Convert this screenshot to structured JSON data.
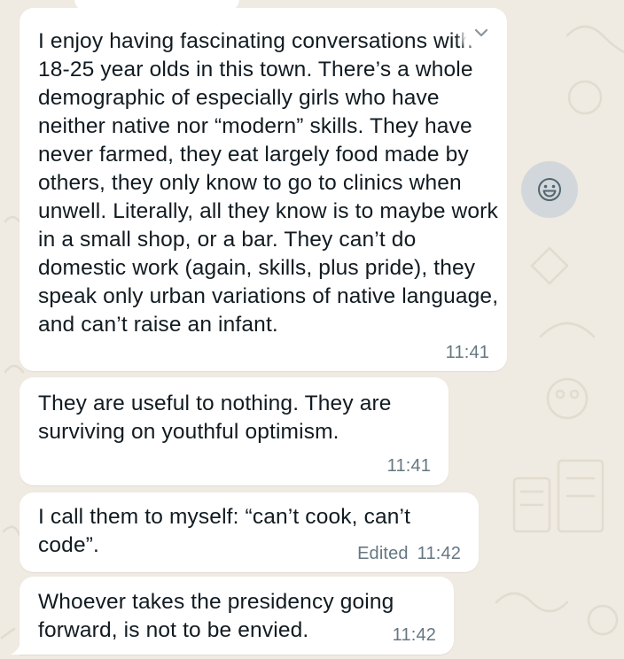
{
  "chat": {
    "messages": [
      {
        "text": "I enjoy having fascinating conversations with 18-25 year olds in this town. There’s a whole demographic of especially girls who have neither native nor “modern” skills. They have never farmed, they eat largely food made by others, they only know to go to clinics when unwell. Literally, all they know is to maybe work in a small shop, or a bar. They can’t do domestic work (again, skills, plus pride), they speak only urban variations of native language, and can’t raise an infant.",
        "time": "11:41"
      },
      {
        "text": "They are useful to nothing. They are surviving on youthful optimism.",
        "time": "11:41"
      },
      {
        "text": "I call them to myself: “can’t cook, can’t code”.",
        "edited": "Edited",
        "time": "11:42"
      },
      {
        "text": "Whoever takes the presidency going forward, is not to be envied.",
        "time": "11:42"
      }
    ]
  },
  "icons": {
    "message_menu": "chevron-down-icon",
    "reaction": "smiley-face-icon"
  },
  "colors": {
    "chat_background": "#efeae2",
    "bubble_background": "#ffffff",
    "text": "#111b21",
    "meta_text": "#667781",
    "reaction_button": "#d1d7db"
  }
}
